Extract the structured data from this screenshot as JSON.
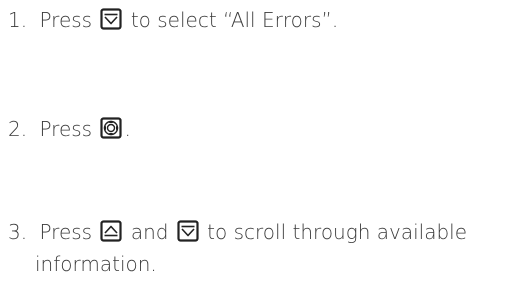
{
  "steps": [
    {
      "number": "1.",
      "text_before": "Press",
      "icon": "down-arrow-button-icon",
      "text_after": "to select “All Errors”."
    },
    {
      "number": "2.",
      "text_before": "Press",
      "icon": "select-center-button-icon",
      "text_after": "."
    },
    {
      "number": "3.",
      "text_before": "Press",
      "icon_1": "up-arrow-button-icon",
      "text_middle": "and",
      "icon_2": "down-arrow-button-icon",
      "text_after": "to scroll through available",
      "text_line2": "information."
    }
  ]
}
